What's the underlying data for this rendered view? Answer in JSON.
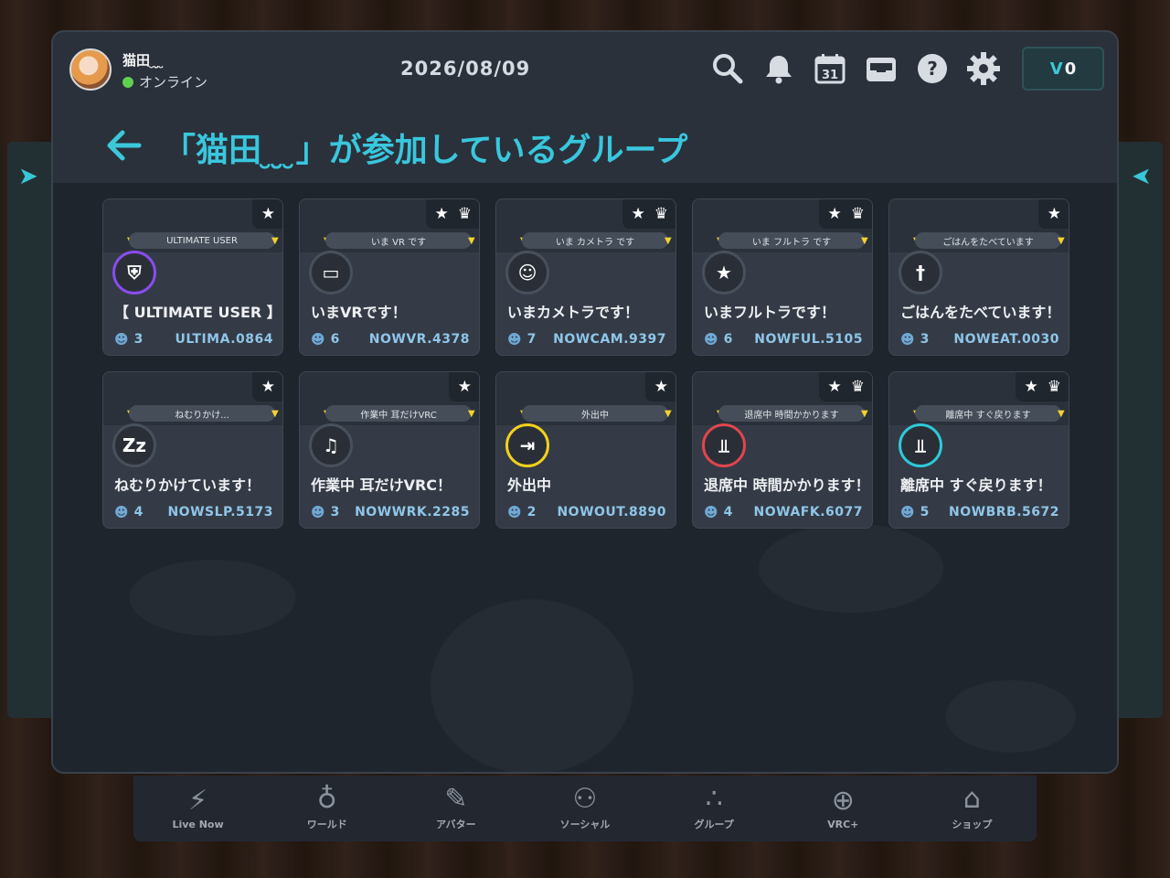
{
  "header": {
    "user_name": "猫田 ̮ ̮̮̮̮ ̮",
    "status": "オンライン",
    "date": "2026/08/09",
    "currency": "0",
    "icons": [
      "search-icon",
      "bell-icon",
      "calendar-icon",
      "inbox-icon",
      "help-icon",
      "gear-icon"
    ],
    "calendar_day": "31"
  },
  "page": {
    "title": "「猫田 ̮ ̮̮̮̮ ̮」が参加しているグループ"
  },
  "groups": [
    {
      "name": "【 ULTIMATE USER 】",
      "banner": "ULTIMATE USER",
      "members": "3",
      "code": "ULTIMA.0864",
      "icon": "shield-icon",
      "crown": false,
      "ring": "#8a4cf0"
    },
    {
      "name": "いまVRです！",
      "banner": "いま VR です",
      "members": "6",
      "code": "NOWVR.4378",
      "icon": "vr-headset-icon",
      "crown": true,
      "ring": "#48505c"
    },
    {
      "name": "いまカメトラです！",
      "banner": "いま カメトラ です",
      "members": "7",
      "code": "NOWCAM.9397",
      "icon": "camera-tracking-icon",
      "crown": true,
      "ring": "#48505c"
    },
    {
      "name": "いまフルトラです！",
      "banner": "いま フルトラ です",
      "members": "6",
      "code": "NOWFUL.5105",
      "icon": "running-icon",
      "crown": true,
      "ring": "#48505c"
    },
    {
      "name": "ごはんをたべています！",
      "banner": "ごはんをたべています",
      "members": "3",
      "code": "NOWEAT.0030",
      "icon": "utensils-icon",
      "crown": false,
      "ring": "#48505c"
    },
    {
      "name": "ねむりかけています！",
      "banner": "ねむりかけ...",
      "members": "4",
      "code": "NOWSLP.5173",
      "icon": "sleep-icon",
      "crown": false,
      "ring": "#48505c"
    },
    {
      "name": "作業中 耳だけVRC！",
      "banner": "作業中 耳だけVRC",
      "members": "3",
      "code": "NOWWRK.2285",
      "icon": "headphones-icon",
      "crown": false,
      "ring": "#48505c"
    },
    {
      "name": "外出中",
      "banner": "外出中",
      "members": "2",
      "code": "NOWOUT.8890",
      "icon": "exit-icon",
      "crown": false,
      "ring": "#f2d01c"
    },
    {
      "name": "退席中 時間かかります！",
      "banner": "退席中 時間かかります",
      "members": "4",
      "code": "NOWAFK.6077",
      "icon": "chair-icon",
      "crown": true,
      "ring": "#e0454f"
    },
    {
      "name": "離席中 すぐ戻ります！",
      "banner": "離席中 すぐ戻ります",
      "members": "5",
      "code": "NOWBRB.5672",
      "icon": "chair-icon",
      "crown": true,
      "ring": "#2ec8d8"
    }
  ],
  "nav": [
    {
      "label": "Live Now",
      "icon": "lightning-icon"
    },
    {
      "label": "ワールド",
      "icon": "planet-icon"
    },
    {
      "label": "アバター",
      "icon": "avatar-icon"
    },
    {
      "label": "ソーシャル",
      "icon": "people-icon"
    },
    {
      "label": "グループ",
      "icon": "group-icon"
    },
    {
      "label": "VRC+",
      "icon": "vrc-plus-icon"
    },
    {
      "label": "ショップ",
      "icon": "shop-icon"
    }
  ]
}
